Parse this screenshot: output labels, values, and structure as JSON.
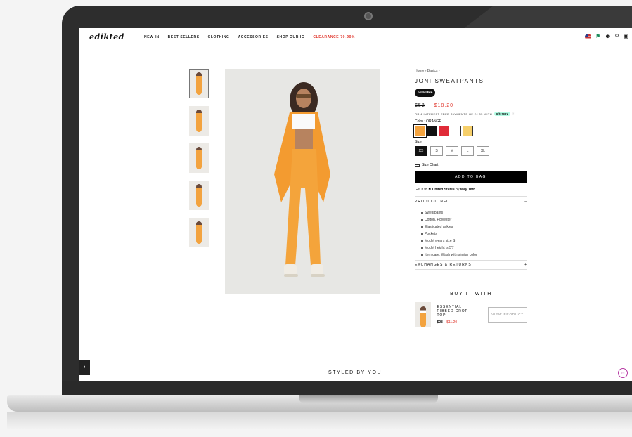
{
  "header": {
    "logo": "edikted",
    "menu": [
      "NEW IN",
      "BEST SELLERS",
      "CLOTHING",
      "ACCESSORIES",
      "SHOP OUR IG",
      "CLEARANCE 70-90%"
    ],
    "icons": [
      "us-flag-icon",
      "rewards-icon",
      "account-icon",
      "search-icon",
      "bag-icon"
    ]
  },
  "product": {
    "breadcrumb": "Home › Basics ›",
    "title": "JONI SWEATPANTS",
    "badge": "65% OFF",
    "price_old": "$52",
    "price_new": "$18.20",
    "afterpay_text": "OR 4 INTEREST-FREE PAYMENTS OF $4.55 WITH",
    "afterpay_logo": "afterpay",
    "color_label": "Color : ORANGE",
    "swatch_colors": [
      "#f3a33f",
      "#111111",
      "#e02b38",
      "#ffffff",
      "#f6cf6a"
    ],
    "size_label": "Size",
    "sizes": [
      "XS",
      "S",
      "M",
      "L",
      "XL"
    ],
    "selected_size": "XS",
    "size_chart": "Size Chart",
    "add_to_bag": "ADD TO BAG",
    "ship_prefix": "Get it to",
    "ship_country": "United States",
    "ship_by": "by",
    "ship_date": "May 18th",
    "product_info_label": "PRODUCT INFO",
    "product_info_toggle": "–",
    "details": [
      "Sweatpants",
      "Cotton, Polyester",
      "Elasticated ankles",
      "Pockets",
      "Model wears size S",
      "Model height is 5'7",
      "Item care: Wash with similar color"
    ],
    "exchanges_label": "EXCHANGES & RETURNS",
    "exchanges_toggle": "+"
  },
  "buy_it_with": {
    "title": "BUY IT WITH",
    "item_name": "ESSENTIAL RIBBED CROP TOP",
    "price_old": "$28",
    "price_new": "$11.20",
    "button": "VIEW PRODUCT"
  },
  "styled_by_you": "STYLED BY YOU"
}
